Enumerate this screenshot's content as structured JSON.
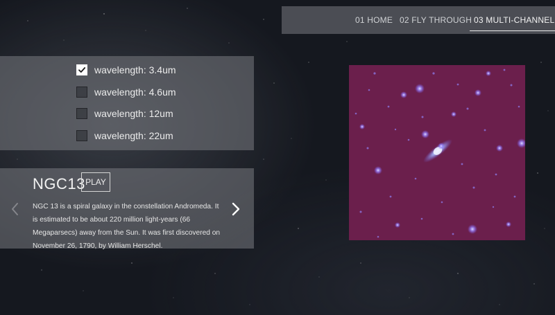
{
  "nav": {
    "items": [
      {
        "label": "01 HOME"
      },
      {
        "label": "02 FLY THROUGH"
      },
      {
        "label": "03 MULTI-CHANNEL"
      }
    ],
    "active_index": 2
  },
  "wavelengths": [
    {
      "label": "wavelength: 3.4um",
      "checked": true
    },
    {
      "label": "wavelength: 4.6um",
      "checked": false
    },
    {
      "label": "wavelength: 12um",
      "checked": false
    },
    {
      "label": "wavelength: 22um",
      "checked": false
    }
  ],
  "info": {
    "title": "NGC13",
    "play_label": "PLAY",
    "description": "NGC 13 is a spiral galaxy in the constellation Andromeda. It is estimated to be about 220 million light-years (66 Megaparsecs) away from the Sun. It was first discovered on November 26, 1790, by William Herschel.",
    "prev_icon": "chevron-left-icon",
    "next_icon": "chevron-right-icon"
  },
  "colors": {
    "image_background": "#6b1f4c",
    "star_color": "#a98bff"
  }
}
